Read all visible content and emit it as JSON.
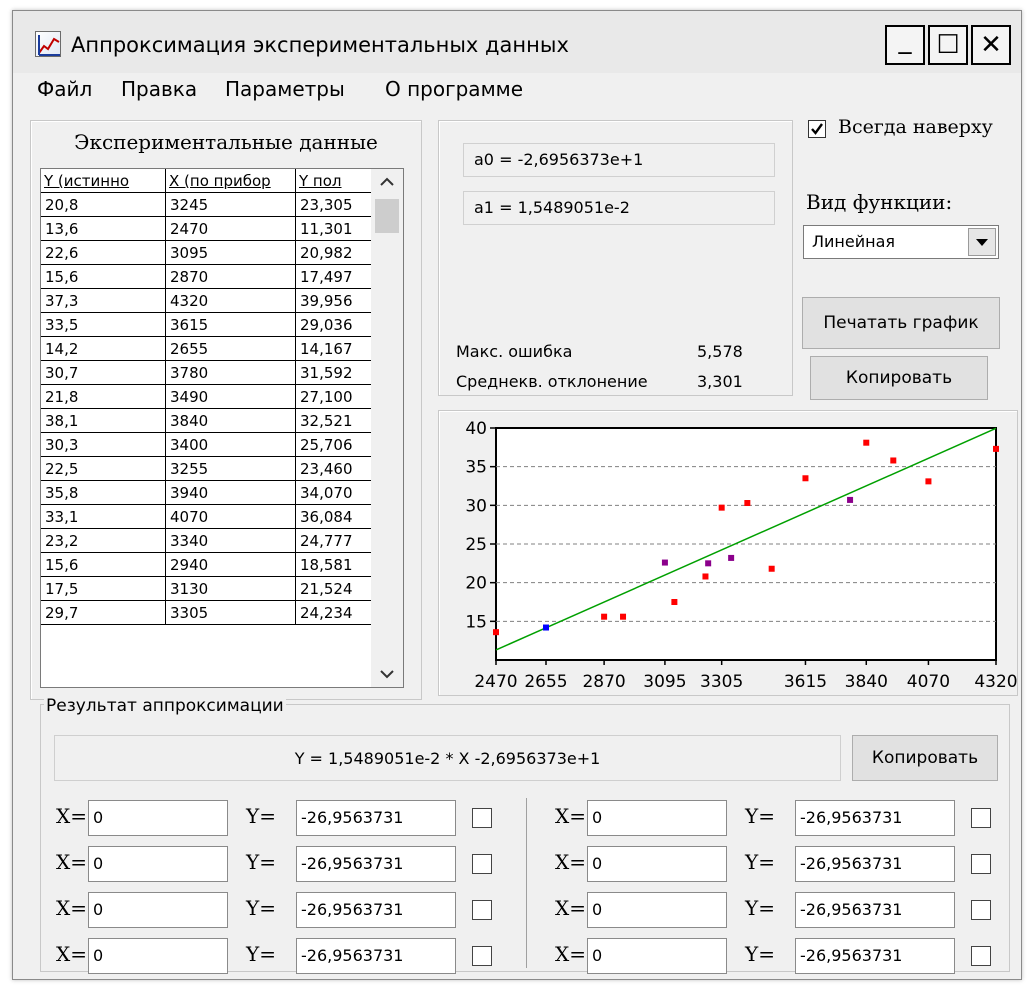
{
  "window": {
    "title": "Аппроксимация экспериментальных данных",
    "controls": {
      "minimize": "_",
      "maximize": "☐",
      "close": "✕"
    }
  },
  "menu": {
    "items": [
      "Файл",
      "Правка",
      "Параметры",
      "О программе"
    ]
  },
  "data_table": {
    "title": "Экспериментальные данные",
    "columns": [
      "Y (истинно",
      "X (по прибор",
      "Y пол"
    ],
    "rows": [
      [
        "20,8",
        "3245",
        "23,305"
      ],
      [
        "13,6",
        "2470",
        "11,301"
      ],
      [
        "22,6",
        "3095",
        "20,982"
      ],
      [
        "15,6",
        "2870",
        "17,497"
      ],
      [
        "37,3",
        "4320",
        "39,956"
      ],
      [
        "33,5",
        "3615",
        "29,036"
      ],
      [
        "14,2",
        "2655",
        "14,167"
      ],
      [
        "30,7",
        "3780",
        "31,592"
      ],
      [
        "21,8",
        "3490",
        "27,100"
      ],
      [
        "38,1",
        "3840",
        "32,521"
      ],
      [
        "30,3",
        "3400",
        "25,706"
      ],
      [
        "22,5",
        "3255",
        "23,460"
      ],
      [
        "35,8",
        "3940",
        "34,070"
      ],
      [
        "33,1",
        "4070",
        "36,084"
      ],
      [
        "23,2",
        "3340",
        "24,777"
      ],
      [
        "15,6",
        "2940",
        "18,581"
      ],
      [
        "17,5",
        "3130",
        "21,524"
      ],
      [
        "29,7",
        "3305",
        "24,234"
      ]
    ]
  },
  "coefficients": {
    "a0": "a0 = -2,6956373e+1",
    "a1": "a1 = 1,5489051e-2",
    "max_error_label": "Макс. ошибка",
    "max_error_value": "5,578",
    "rms_label": "Среднекв. отклонение",
    "rms_value": "3,301"
  },
  "options": {
    "always_on_top_label": "Всегда наверху",
    "always_on_top_checked": true,
    "function_type_label": "Вид функции:",
    "function_type_value": "Линейная"
  },
  "buttons": {
    "print_chart": "Печатать график",
    "copy": "Копировать",
    "copy_result": "Копировать"
  },
  "chart_data": {
    "type": "scatter",
    "x_ticks": [
      "2470",
      "2655",
      "2870",
      "3095",
      "3305",
      "3615",
      "3840",
      "4070",
      "4320"
    ],
    "y_ticks": [
      "40",
      "35",
      "30",
      "25",
      "20",
      "15"
    ],
    "xlim": [
      2470,
      4320
    ],
    "ylim": [
      10,
      40
    ],
    "points_red": [
      [
        2470,
        13.6
      ],
      [
        2870,
        15.6
      ],
      [
        2940,
        15.6
      ],
      [
        3130,
        17.5
      ],
      [
        3245,
        20.8
      ],
      [
        3305,
        29.7
      ],
      [
        3400,
        30.3
      ],
      [
        3490,
        21.8
      ],
      [
        3615,
        33.5
      ],
      [
        3840,
        38.1
      ],
      [
        3940,
        35.8
      ],
      [
        4070,
        33.1
      ],
      [
        4320,
        37.3
      ]
    ],
    "points_purple": [
      [
        3095,
        22.6
      ],
      [
        3255,
        22.5
      ],
      [
        3340,
        23.2
      ],
      [
        3780,
        30.7
      ]
    ],
    "points_blue": [
      [
        2655,
        14.2
      ]
    ],
    "fit_line": [
      [
        2470,
        11.301
      ],
      [
        4320,
        39.956
      ]
    ],
    "grid": true,
    "colors": {
      "red": "#ff0000",
      "purple": "#8b008b",
      "blue": "#0000ff",
      "line": "#00a000",
      "grid": "#808080"
    }
  },
  "result": {
    "group_title": "Результат аппроксимации",
    "formula": "Y = 1,5489051e-2 * X -2,6956373e+1",
    "x_label": "X=",
    "y_label": "Y=",
    "left_rows": [
      {
        "x": "0",
        "y": "-26,9563731"
      },
      {
        "x": "0",
        "y": "-26,9563731"
      },
      {
        "x": "0",
        "y": "-26,9563731"
      },
      {
        "x": "0",
        "y": "-26,9563731"
      }
    ],
    "right_rows": [
      {
        "x": "0",
        "y": "-26,9563731"
      },
      {
        "x": "0",
        "y": "-26,9563731"
      },
      {
        "x": "0",
        "y": "-26,9563731"
      },
      {
        "x": "0",
        "y": "-26,9563731"
      }
    ]
  }
}
